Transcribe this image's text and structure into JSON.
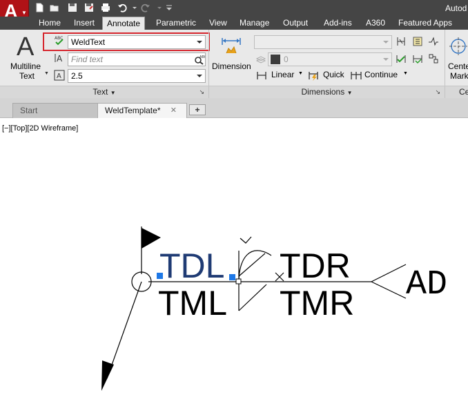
{
  "window": {
    "title_partial": "Autod"
  },
  "quick_access": [
    "new-icon",
    "open-icon",
    "save-icon",
    "save-as-icon",
    "print-icon",
    "undo-icon",
    "redo-icon",
    "customize-icon"
  ],
  "tabs": [
    {
      "label": "Home"
    },
    {
      "label": "Insert"
    },
    {
      "label": "Annotate",
      "active": true
    },
    {
      "label": "Parametric"
    },
    {
      "label": "View"
    },
    {
      "label": "Manage"
    },
    {
      "label": "Output"
    },
    {
      "label": "Add-ins"
    },
    {
      "label": "A360"
    },
    {
      "label": "Featured Apps"
    }
  ],
  "text_panel": {
    "big_button_line1": "Multiline",
    "big_button_line2": "Text",
    "text_style": "WeldText",
    "find_placeholder": "Find text",
    "height_value": "2.5",
    "panel_title": "Text"
  },
  "dimensions_panel": {
    "big_button": "Dimension",
    "dim_style": "",
    "layer_value": "0",
    "linear": "Linear",
    "quick": "Quick",
    "continue": "Continue",
    "panel_title": "Dimensions"
  },
  "center_panel": {
    "line1": "Cente",
    "line2": "Mark",
    "panel_title_partial": "Ce"
  },
  "file_tabs": [
    {
      "label": "Start"
    },
    {
      "label": "WeldTemplate*",
      "active": true
    }
  ],
  "viewport": {
    "label": "[−][Top][2D Wireframe]"
  },
  "weld_symbol": {
    "text_top_left": "TDL",
    "text_top_right": "TDR",
    "text_bottom_left": "TML",
    "text_bottom_right": "TMR",
    "tail_text": "AD"
  },
  "colors": {
    "app_red": "#b01217",
    "highlight_red": "#d6262e",
    "selection_blue": "#1e78e6",
    "dark_chrome": "#454545"
  }
}
